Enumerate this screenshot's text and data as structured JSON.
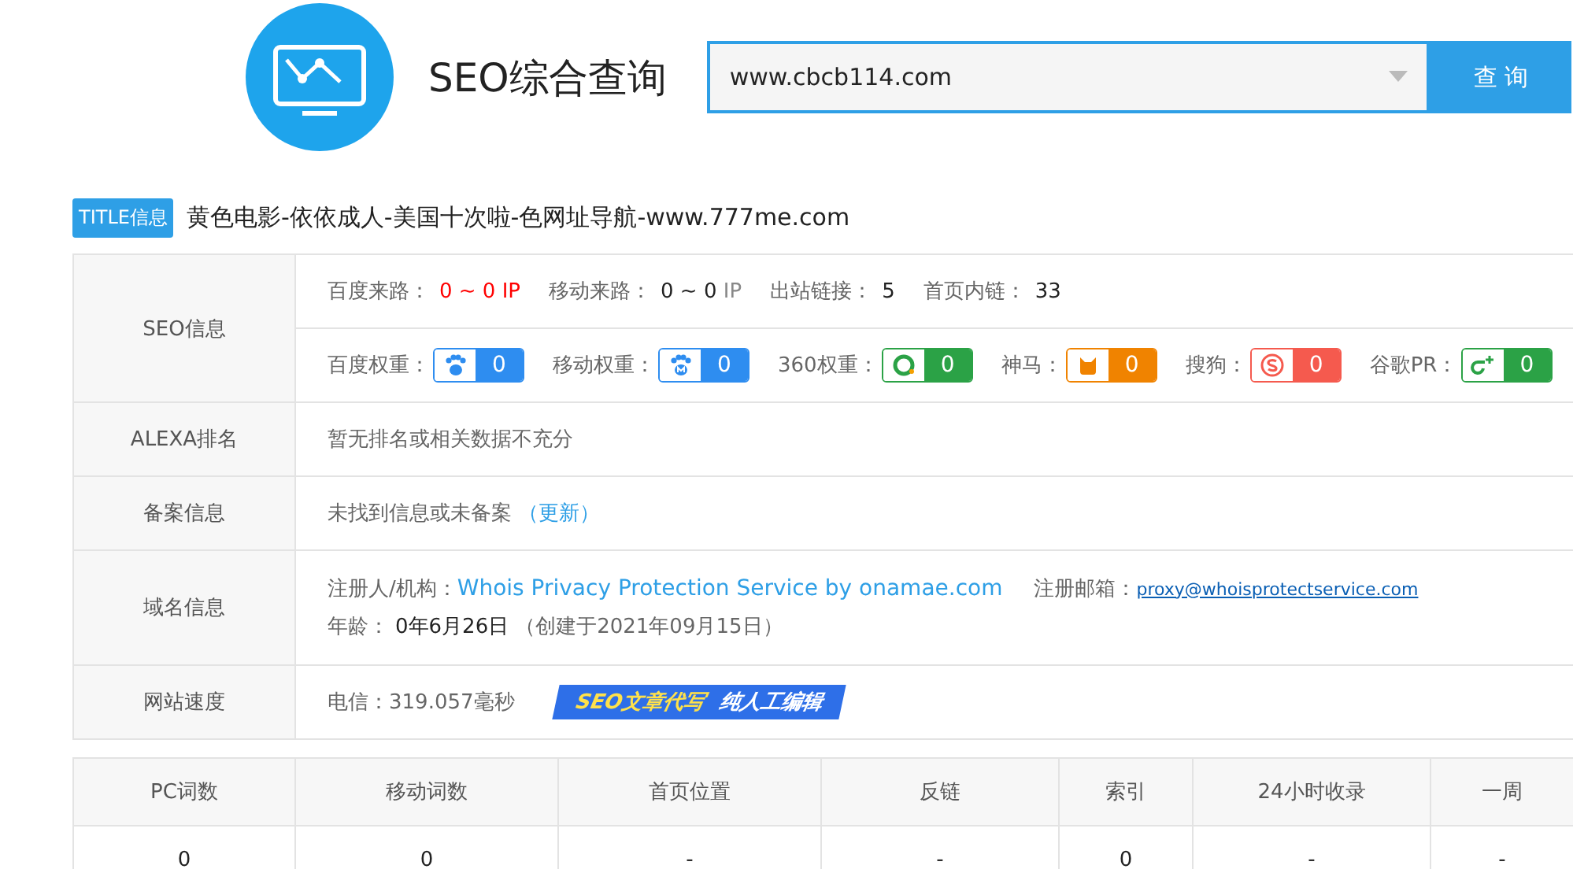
{
  "header": {
    "title": "SEO综合查询",
    "search": {
      "value": "www.cbcb114.com"
    },
    "button": "查 询"
  },
  "title_info": {
    "badge": "TITLE信息",
    "text": "黄色电影-依依成人-美国十次啦-色网址导航-www.777me.com"
  },
  "seo": {
    "label": "SEO信息",
    "metrics": [
      {
        "label": "百度来路：",
        "value": "0 ~ 0",
        "unit": "IP",
        "alert": true
      },
      {
        "label": "移动来路：",
        "value": "0 ~ 0",
        "unit": "IP",
        "alert": false
      },
      {
        "label": "出站链接：",
        "value": "5",
        "alert": false
      },
      {
        "label": "首页内链：",
        "value": "33",
        "alert": false
      }
    ],
    "weights": [
      {
        "label": "百度权重：",
        "value": "0",
        "kind": "paw",
        "color": "#2e8df0"
      },
      {
        "label": "移动权重：",
        "value": "0",
        "kind": "paw-m",
        "color": "#2e8df0"
      },
      {
        "label": "360权重：",
        "value": "0",
        "kind": "ring",
        "color": "#2ba246"
      },
      {
        "label": "神马：",
        "value": "0",
        "kind": "cat",
        "color": "#f08300"
      },
      {
        "label": "搜狗：",
        "value": "0",
        "kind": "s",
        "color": "#f55a4e"
      },
      {
        "label": "谷歌PR：",
        "value": "0",
        "kind": "g",
        "color": "#2ba246"
      }
    ]
  },
  "alexa": {
    "label": "ALEXA排名",
    "text": "暂无排名或相关数据不充分"
  },
  "beian": {
    "label": "备案信息",
    "text": "未找到信息或未备案",
    "open": "（",
    "link": "更新",
    "close": "）"
  },
  "domain": {
    "label": "域名信息",
    "registrant_label": "注册人/机构：",
    "registrant": "Whois Privacy Protection Service by onamae.com",
    "email_label": "注册邮箱：",
    "email": "proxy@whoisprotectservice.com",
    "age_label": "年龄：",
    "age": "0年6月26日",
    "created": "（创建于2021年09月15日）"
  },
  "speed": {
    "label": "网站速度",
    "text": "电信：319.057毫秒",
    "ad": [
      "SEO文章代写",
      "纯人工编辑"
    ]
  },
  "stats": {
    "columns": [
      "PC词数",
      "移动词数",
      "首页位置",
      "反链",
      "索引",
      "24小时收录",
      "一周"
    ],
    "rows": [
      [
        "0",
        "0",
        "-",
        "-",
        "0",
        "-",
        "-"
      ]
    ]
  }
}
